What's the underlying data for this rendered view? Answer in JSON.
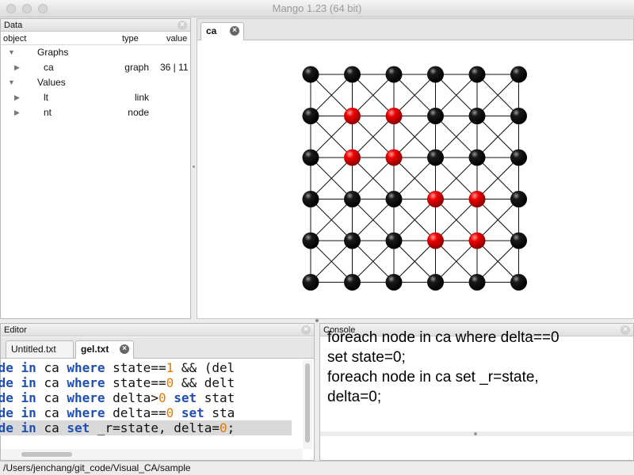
{
  "window": {
    "title": "Mango 1.23 (64 bit)"
  },
  "data_panel": {
    "title": "Data",
    "columns": {
      "object": "object",
      "type": "type",
      "value": "value"
    },
    "tree": [
      {
        "label": "Graphs",
        "type": "",
        "value": "",
        "expanded": true,
        "level": 0
      },
      {
        "label": "ca",
        "type": "graph",
        "value": "36 | 11",
        "expanded": false,
        "level": 1
      },
      {
        "label": "Values",
        "type": "",
        "value": "",
        "expanded": true,
        "level": 0
      },
      {
        "label": "lt",
        "type": "link",
        "value": "",
        "expanded": false,
        "level": 1
      },
      {
        "label": "nt",
        "type": "node",
        "value": "",
        "expanded": false,
        "level": 1
      }
    ]
  },
  "graph_view": {
    "tab": "ca",
    "grid_rows": 6,
    "grid_cols": 6,
    "red_nodes": [
      [
        1,
        1
      ],
      [
        1,
        2
      ],
      [
        2,
        1
      ],
      [
        2,
        2
      ],
      [
        3,
        3
      ],
      [
        3,
        4
      ],
      [
        4,
        3
      ],
      [
        4,
        4
      ]
    ],
    "colors": {
      "black": "#000000",
      "red": "#e00000"
    }
  },
  "editor": {
    "title": "Editor",
    "tabs": [
      "Untitled.txt",
      "gel.txt"
    ],
    "active_tab": 1,
    "lines": [
      [
        {
          "t": "ode",
          "c": "kw"
        },
        {
          "t": " ",
          "c": ""
        },
        {
          "t": "in",
          "c": "kw"
        },
        {
          "t": " ca ",
          "c": ""
        },
        {
          "t": "where",
          "c": "kw"
        },
        {
          "t": " state==",
          "c": ""
        },
        {
          "t": "1",
          "c": "num"
        },
        {
          "t": " && (del",
          "c": ""
        }
      ],
      [
        {
          "t": "ode",
          "c": "kw"
        },
        {
          "t": " ",
          "c": ""
        },
        {
          "t": "in",
          "c": "kw"
        },
        {
          "t": " ca ",
          "c": ""
        },
        {
          "t": "where",
          "c": "kw"
        },
        {
          "t": " state==",
          "c": ""
        },
        {
          "t": "0",
          "c": "num"
        },
        {
          "t": " && delt",
          "c": ""
        }
      ],
      [
        {
          "t": "ode",
          "c": "kw"
        },
        {
          "t": " ",
          "c": ""
        },
        {
          "t": "in",
          "c": "kw"
        },
        {
          "t": " ca ",
          "c": ""
        },
        {
          "t": "where",
          "c": "kw"
        },
        {
          "t": " delta>",
          "c": ""
        },
        {
          "t": "0",
          "c": "num"
        },
        {
          "t": " ",
          "c": ""
        },
        {
          "t": "set",
          "c": "kw"
        },
        {
          "t": " stat",
          "c": ""
        }
      ],
      [
        {
          "t": "ode",
          "c": "kw"
        },
        {
          "t": " ",
          "c": ""
        },
        {
          "t": "in",
          "c": "kw"
        },
        {
          "t": " ca ",
          "c": ""
        },
        {
          "t": "where",
          "c": "kw"
        },
        {
          "t": " delta==",
          "c": ""
        },
        {
          "t": "0",
          "c": "num"
        },
        {
          "t": " ",
          "c": ""
        },
        {
          "t": "set",
          "c": "kw"
        },
        {
          "t": " sta",
          "c": ""
        }
      ],
      [
        {
          "t": "ode",
          "c": "kw"
        },
        {
          "t": " ",
          "c": ""
        },
        {
          "t": "in",
          "c": "kw"
        },
        {
          "t": " ca ",
          "c": ""
        },
        {
          "t": "set",
          "c": "kw"
        },
        {
          "t": " _r=state, delta=",
          "c": ""
        },
        {
          "t": "0",
          "c": "num"
        },
        {
          "t": ";",
          "c": ""
        }
      ]
    ],
    "highlighted_line": 4
  },
  "console": {
    "title": "Console",
    "lines": [
      "foreach node in ca where delta==0",
      "set state=0;",
      "foreach node in ca set _r=state,",
      "delta=0;"
    ]
  },
  "status": {
    "path": "/Users/jenchang/git_code/Visual_CA/sample"
  }
}
